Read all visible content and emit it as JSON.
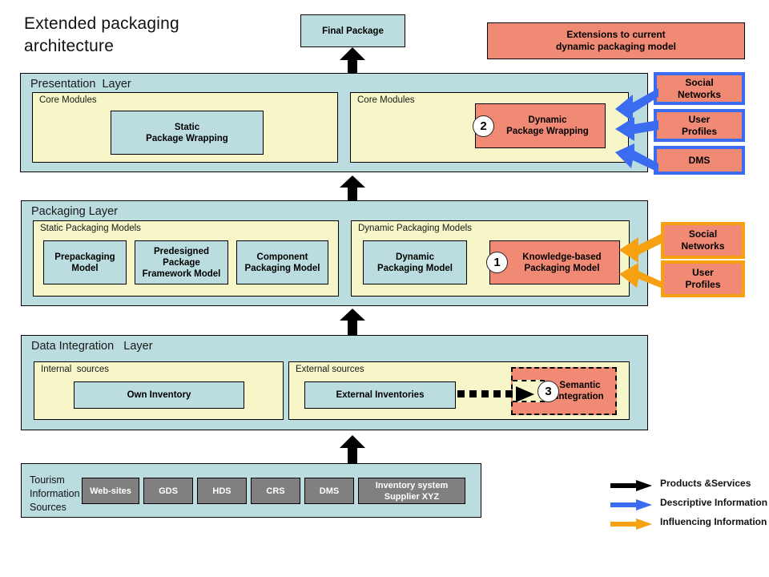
{
  "title": "Extended packaging\narchitecture",
  "top": {
    "final_package": "Final Package",
    "extensions_note": "Extensions to current\ndynamic packaging model"
  },
  "presentation_layer": {
    "title": "Presentation  Layer",
    "left_group": {
      "title": "Core Modules",
      "node": "Static\nPackage Wrapping"
    },
    "right_group": {
      "title": "Core Modules",
      "node": "Dynamic\nPackage Wrapping",
      "marker": "2"
    },
    "side_boxes": [
      {
        "label": "Social\nNetworks"
      },
      {
        "label": "User\nProfiles"
      },
      {
        "label": "DMS"
      }
    ]
  },
  "packaging_layer": {
    "title": "Packaging Layer",
    "left_group": {
      "title": "Static Packaging Models",
      "nodes": [
        "Prepackaging\nModel",
        "Predesigned\nPackage\nFramework Model",
        "Component\nPackaging Model"
      ]
    },
    "right_group": {
      "title": "Dynamic Packaging Models",
      "nodes": [
        "Dynamic\nPackaging Model"
      ],
      "highlight_node": "Knowledge-based\nPackaging Model",
      "marker": "1"
    },
    "side_boxes": [
      {
        "label": "Social\nNetworks"
      },
      {
        "label": "User\nProfiles"
      }
    ]
  },
  "data_integration_layer": {
    "title": "Data Integration   Layer",
    "internal_group": {
      "title": "Internal  sources",
      "node": "Own Inventory"
    },
    "external_group": {
      "title": "External sources",
      "node": "External Inventories",
      "highlight_node": "Semantic\nIntegration",
      "marker": "3"
    }
  },
  "sources_bar": {
    "label": "Tourism\nInformation\nSources",
    "items": [
      "Web-sites",
      "GDS",
      "HDS",
      "CRS",
      "DMS",
      "Inventory  system\nSupplier XYZ"
    ]
  },
  "legend": {
    "items": [
      {
        "label": "Products &Services",
        "color": "#000000"
      },
      {
        "label": "Descriptive Information",
        "color": "#3b6cf0"
      },
      {
        "label": "Influencing Information",
        "color": "#f7a012"
      }
    ]
  },
  "colors": {
    "layer_fill": "#bcdde0",
    "group_fill": "#f6f6c8",
    "accent_salmon": "#f08a75",
    "accent_blue": "#3b6cf0",
    "accent_orange": "#f7a012",
    "grey_node": "#808080"
  }
}
